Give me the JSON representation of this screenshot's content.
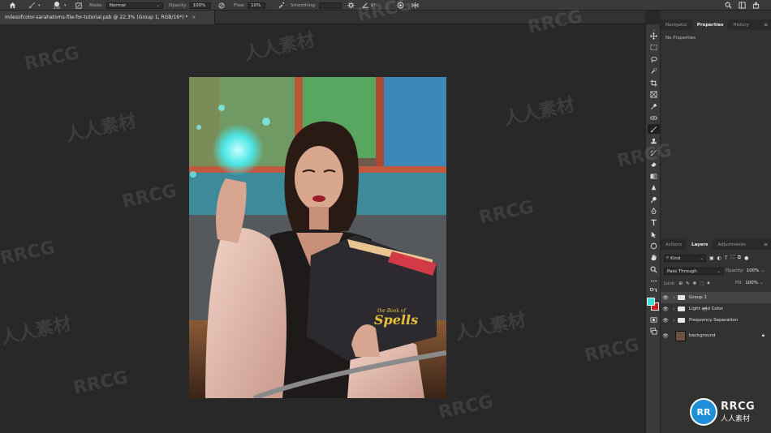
{
  "options_bar": {
    "brush_size": "250",
    "mode_label": "Mode:",
    "mode_value": "Normal",
    "opacity_label": "Opacity:",
    "opacity_value": "100%",
    "flow_label": "Flow:",
    "flow_value": "10%",
    "smoothing_label": "Smoothing:",
    "smoothing_value": "",
    "angle_value": "0°"
  },
  "document_tab": {
    "title": "milesofcolor-sarahatoms-file-for-tutorial.psb @ 22.3% (Group 1, RGB/16*) *",
    "close": "×"
  },
  "top_panel": {
    "tabs": [
      "Navigator",
      "Properties",
      "History"
    ],
    "active_tab": "Properties",
    "no_properties": "No Properties"
  },
  "layers_panel": {
    "tabs": [
      "Actions",
      "Layers",
      "Adjustments"
    ],
    "active_tab": "Layers",
    "filter_kind": "Kind",
    "blend_mode": "Pass Through",
    "opacity_label": "Opacity:",
    "opacity_value": "100%",
    "lock_label": "Lock:",
    "fill_label": "Fill:",
    "fill_value": "100%",
    "layers": [
      {
        "name": "Group 1",
        "type": "group",
        "selected": true
      },
      {
        "name": "Light and Color",
        "type": "group",
        "selected": false
      },
      {
        "name": "Frequency Separation",
        "type": "group",
        "selected": false
      },
      {
        "name": "background",
        "type": "image",
        "selected": false,
        "locked": true
      }
    ]
  },
  "colors": {
    "foreground": "#3ee0d8",
    "background": "#c81e1e"
  },
  "photo": {
    "book_text_small": "the Book of",
    "book_text_main": "Spells"
  },
  "watermarks": {
    "en": "RRCG",
    "cn": "人人素材"
  },
  "logo": {
    "mark": "RR",
    "line1": "RRCG",
    "line2": "人人素材"
  },
  "icons": [
    "home-icon",
    "brush-icon",
    "brush-settings-icon",
    "pressure-opacity-icon",
    "airbrush-icon",
    "smoothing-settings-icon",
    "angle-icon",
    "pressure-size-icon",
    "symmetry-icon",
    "search-icon",
    "workspace-icon",
    "share-icon"
  ]
}
